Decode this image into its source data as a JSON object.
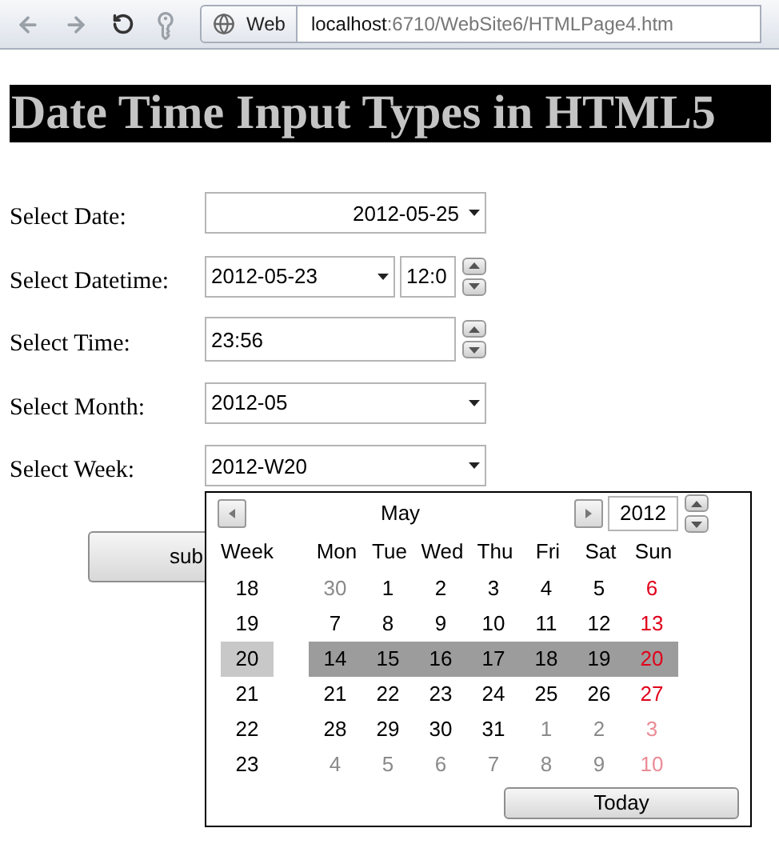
{
  "browser": {
    "mode_button": "Web",
    "address_host": "localhost",
    "address_path": ":6710/WebSite6/HTMLPage4.htm"
  },
  "heading": "Date Time Input Types in HTML5",
  "form": [
    {
      "label": "Select Date:",
      "kind": "date",
      "value": "2012-05-25"
    },
    {
      "label": "Select Datetime:",
      "kind": "datetime",
      "value": "2012-05-23",
      "time": "12:0"
    },
    {
      "label": "Select Time:",
      "kind": "time",
      "value": "23:56"
    },
    {
      "label": "Select Month:",
      "kind": "month",
      "value": "2012-05"
    },
    {
      "label": "Select Week:",
      "kind": "week",
      "value": "2012-W20"
    }
  ],
  "submit_button": "sub",
  "calendar": {
    "month": "May",
    "year": "2012",
    "week_header": "Week",
    "day_headers": [
      "Mon",
      "Tue",
      "Wed",
      "Thu",
      "Fri",
      "Sat",
      "Sun"
    ],
    "today_button": "Today",
    "weeks": [
      {
        "week": "18",
        "selected": false,
        "days": [
          {
            "text": "30",
            "current": false
          },
          {
            "text": "1",
            "current": true
          },
          {
            "text": "2",
            "current": true
          },
          {
            "text": "3",
            "current": true
          },
          {
            "text": "4",
            "current": true
          },
          {
            "text": "5",
            "current": true
          },
          {
            "text": "6",
            "current": true
          }
        ]
      },
      {
        "week": "19",
        "selected": false,
        "days": [
          {
            "text": "7",
            "current": true
          },
          {
            "text": "8",
            "current": true
          },
          {
            "text": "9",
            "current": true
          },
          {
            "text": "10",
            "current": true
          },
          {
            "text": "11",
            "current": true
          },
          {
            "text": "12",
            "current": true
          },
          {
            "text": "13",
            "current": true
          }
        ]
      },
      {
        "week": "20",
        "selected": true,
        "days": [
          {
            "text": "14",
            "current": true
          },
          {
            "text": "15",
            "current": true
          },
          {
            "text": "16",
            "current": true
          },
          {
            "text": "17",
            "current": true
          },
          {
            "text": "18",
            "current": true
          },
          {
            "text": "19",
            "current": true
          },
          {
            "text": "20",
            "current": true
          }
        ]
      },
      {
        "week": "21",
        "selected": false,
        "days": [
          {
            "text": "21",
            "current": true
          },
          {
            "text": "22",
            "current": true
          },
          {
            "text": "23",
            "current": true
          },
          {
            "text": "24",
            "current": true
          },
          {
            "text": "25",
            "current": true
          },
          {
            "text": "26",
            "current": true
          },
          {
            "text": "27",
            "current": true
          }
        ]
      },
      {
        "week": "22",
        "selected": false,
        "days": [
          {
            "text": "28",
            "current": true
          },
          {
            "text": "29",
            "current": true
          },
          {
            "text": "30",
            "current": true
          },
          {
            "text": "31",
            "current": true
          },
          {
            "text": "1",
            "current": false
          },
          {
            "text": "2",
            "current": false
          },
          {
            "text": "3",
            "current": false
          }
        ]
      },
      {
        "week": "23",
        "selected": false,
        "days": [
          {
            "text": "4",
            "current": false
          },
          {
            "text": "5",
            "current": false
          },
          {
            "text": "6",
            "current": false
          },
          {
            "text": "7",
            "current": false
          },
          {
            "text": "8",
            "current": false
          },
          {
            "text": "9",
            "current": false
          },
          {
            "text": "10",
            "current": false
          }
        ]
      }
    ]
  }
}
